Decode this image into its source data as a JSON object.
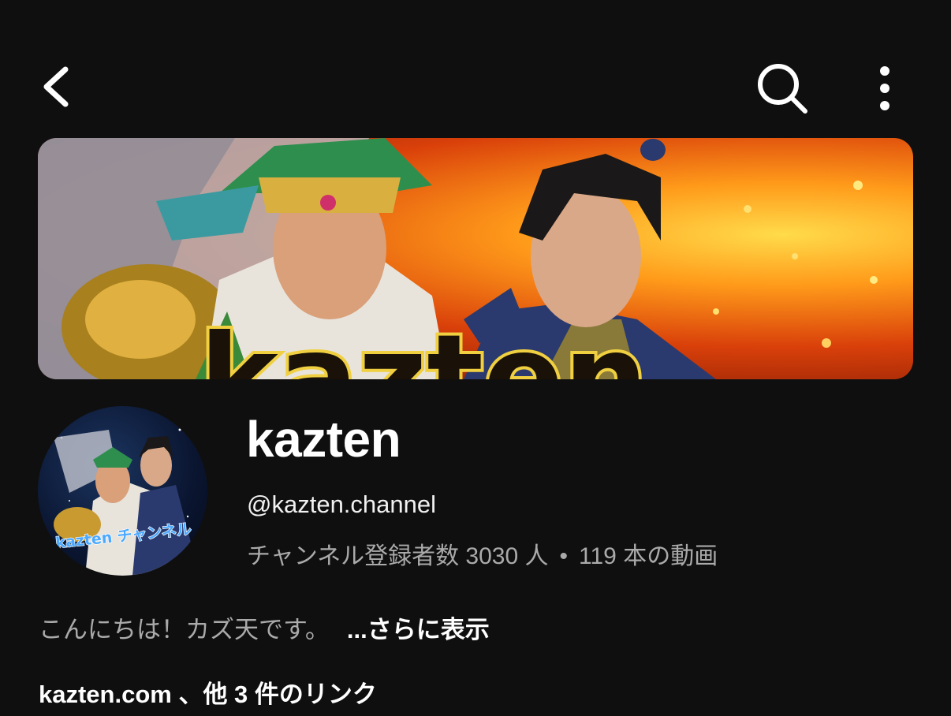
{
  "header": {
    "back_icon": "chevron-left-icon",
    "search_icon": "search-icon",
    "more_icon": "more-vertical-icon"
  },
  "banner": {
    "text": "kazten"
  },
  "avatar": {
    "text": "kazten チャンネル"
  },
  "channel": {
    "name": "kazten",
    "handle": "@kazten.channel",
    "subscribers": "チャンネル登録者数 3030 人",
    "separator": "•",
    "videos": "119 本の動画"
  },
  "description": {
    "text": "こんにちは！カズ天です。",
    "more_label": "...さらに表示"
  },
  "links": {
    "label": "kazten.com 、他 3 件のリンク"
  },
  "colors": {
    "background": "#0f0f0f",
    "primary_text": "#ffffff",
    "secondary_text": "#aaaaaa"
  }
}
